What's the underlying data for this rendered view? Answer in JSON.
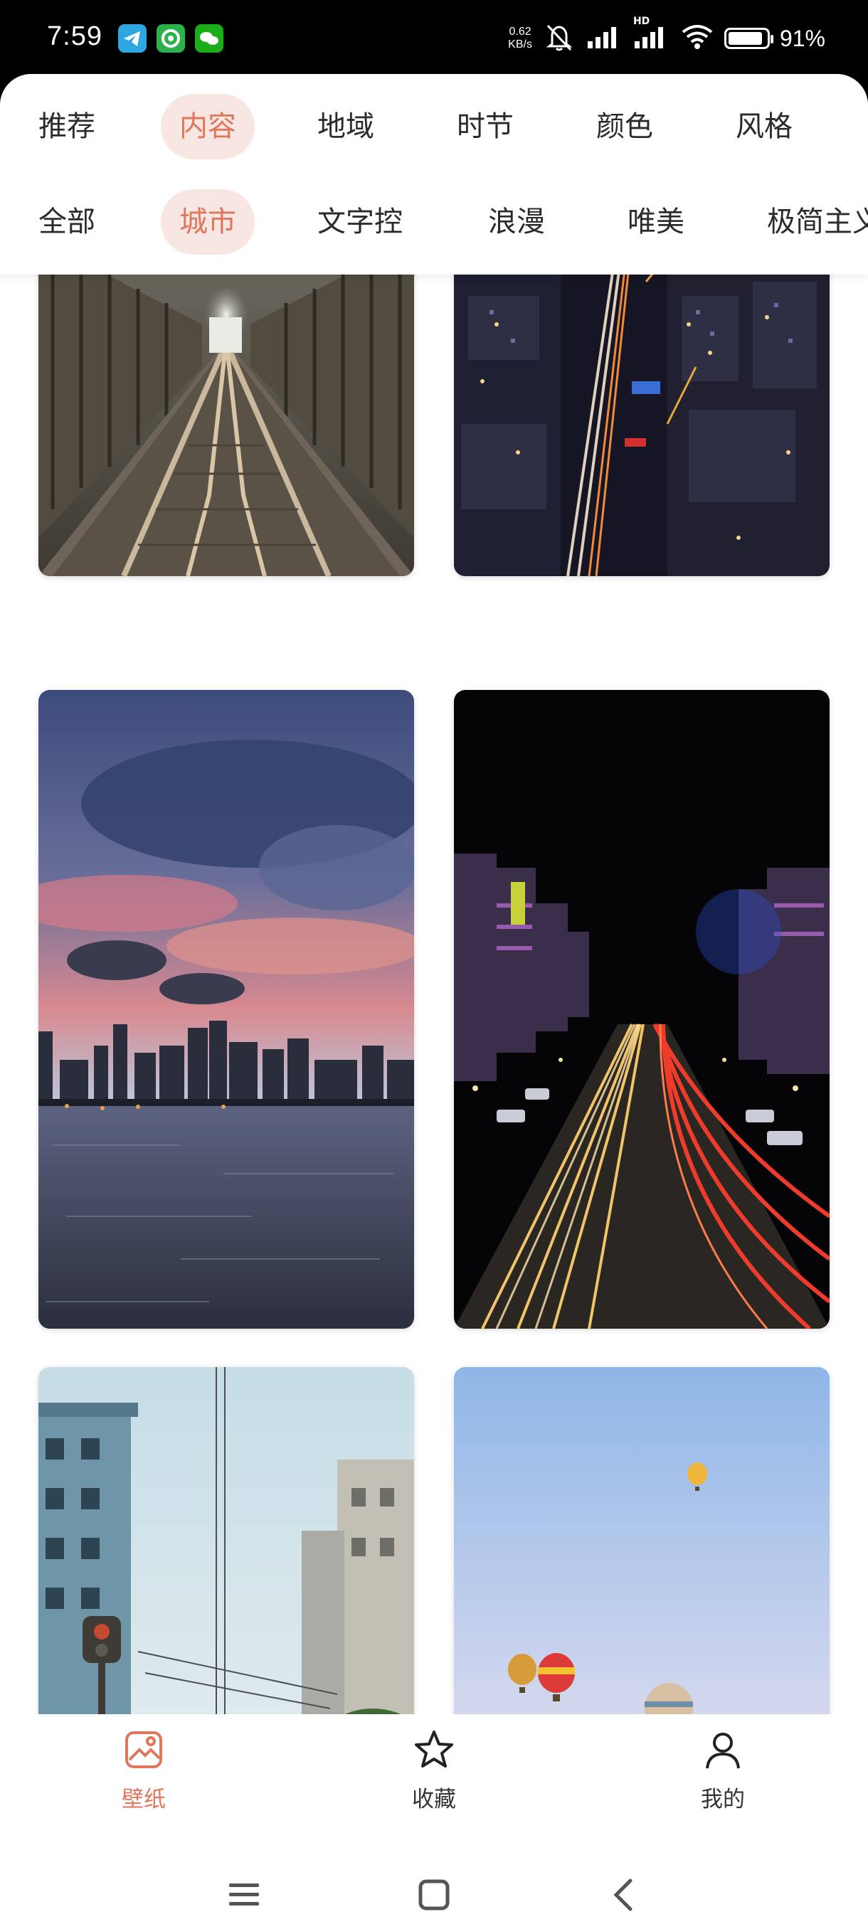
{
  "status": {
    "time": "7:59",
    "net_speed_value": "0.62",
    "net_speed_unit": "KB/s",
    "hd_label": "HD",
    "battery_percent": 91,
    "battery_text": "91%"
  },
  "category_tabs": [
    {
      "label": "推荐",
      "active": false
    },
    {
      "label": "内容",
      "active": true
    },
    {
      "label": "地域",
      "active": false
    },
    {
      "label": "时节",
      "active": false
    },
    {
      "label": "颜色",
      "active": false
    },
    {
      "label": "风格",
      "active": false
    }
  ],
  "sub_tabs": [
    {
      "label": "全部",
      "active": false
    },
    {
      "label": "城市",
      "active": true
    },
    {
      "label": "文字控",
      "active": false
    },
    {
      "label": "浪漫",
      "active": false
    },
    {
      "label": "唯美",
      "active": false
    },
    {
      "label": "极简主义",
      "active": false
    }
  ],
  "wallpapers": [
    {
      "subject": "railway bridge tracks"
    },
    {
      "subject": "night city traffic aerial"
    },
    {
      "subject": "river skyline sunset clouds"
    },
    {
      "subject": "night street light trails"
    },
    {
      "subject": "old buildings power lines"
    },
    {
      "subject": "hot air balloons"
    }
  ],
  "bottom_nav": [
    {
      "label": "壁纸",
      "icon": "wallpaper-icon",
      "active": true
    },
    {
      "label": "收藏",
      "icon": "star-icon",
      "active": false
    },
    {
      "label": "我的",
      "icon": "person-icon",
      "active": false
    }
  ],
  "colors": {
    "accent": "#e0765c",
    "accent_bg": "#f7e6e2"
  }
}
